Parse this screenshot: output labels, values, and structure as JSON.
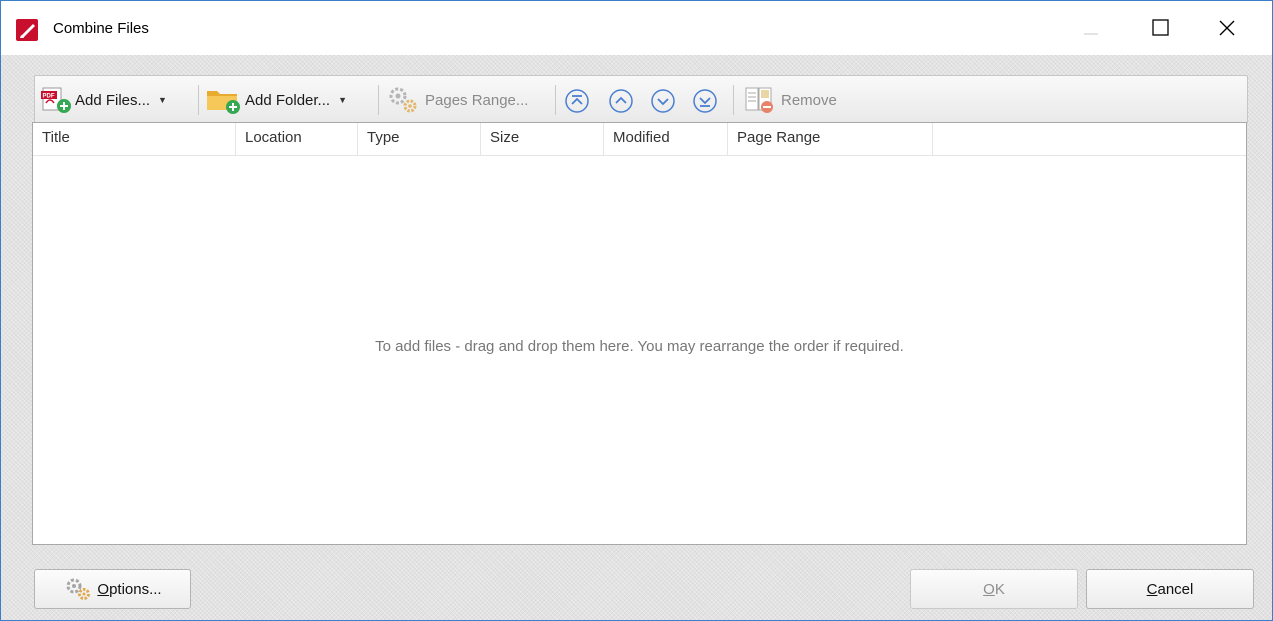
{
  "window": {
    "title": "Combine Files"
  },
  "toolbar": {
    "add_files": "Add Files...",
    "add_folder": "Add Folder...",
    "pages_range": "Pages Range...",
    "remove": "Remove"
  },
  "columns": [
    "Title",
    "Location",
    "Type",
    "Size",
    "Modified",
    "Page Range"
  ],
  "list": {
    "empty_message": "To add files - drag and drop them here. You may rearrange the order if required."
  },
  "footer": {
    "options": {
      "pre": "",
      "accel": "O",
      "post": "ptions..."
    },
    "ok": {
      "pre": "",
      "accel": "O",
      "post": "K"
    },
    "cancel": {
      "pre": "",
      "accel": "C",
      "post": "ancel"
    }
  },
  "colors": {
    "accent_blue": "#3a6fbf",
    "pdf_red": "#c8102e",
    "folder_yellow": "#f2c04b",
    "add_green": "#34a853"
  }
}
